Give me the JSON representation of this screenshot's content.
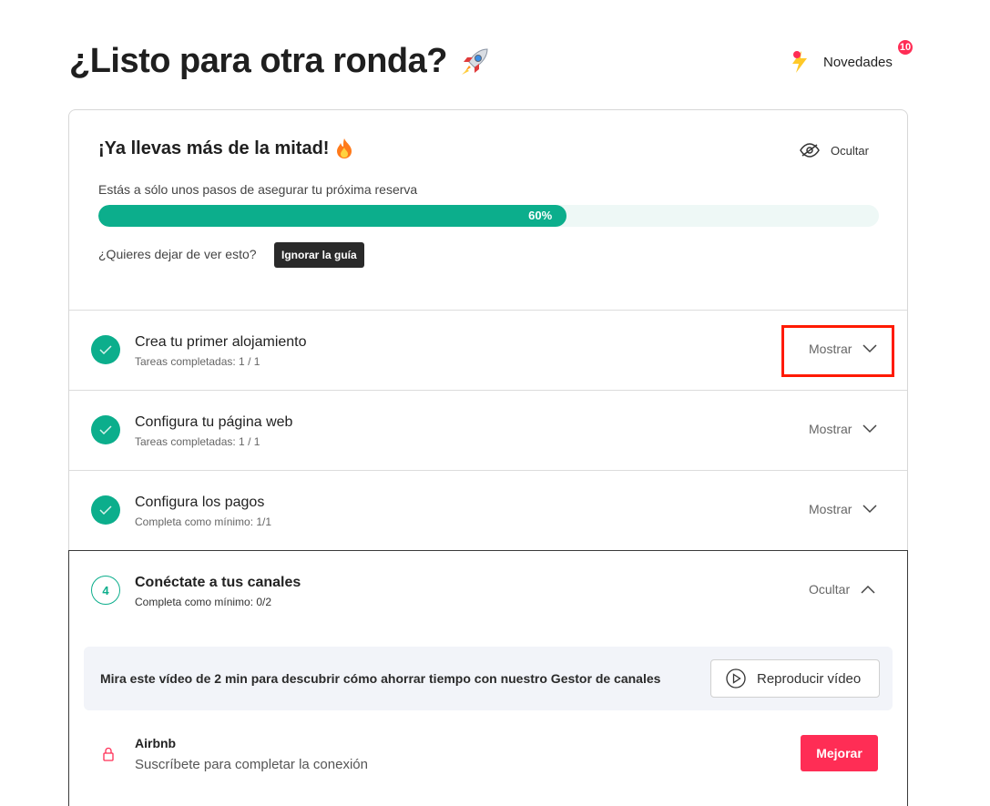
{
  "header": {
    "title": "¿Listo para otra ronda?",
    "news_label": "Novedades",
    "news_badge": "10"
  },
  "guide": {
    "title": "¡Ya llevas más de la mitad!",
    "hide_label": "Ocultar",
    "subtitle": "Estás a sólo unos pasos de asegurar tu próxima reserva",
    "progress_percent": 60,
    "progress_label": "60%",
    "quit_question": "¿Quieres dejar de ver esto?",
    "quit_button": "Ignorar la guía"
  },
  "steps": [
    {
      "title": "Crea tu primer alojamiento",
      "sub": "Tareas completadas: 1 / 1",
      "toggle": "Mostrar",
      "done": true
    },
    {
      "title": "Configura tu página web",
      "sub": "Tareas completadas: 1 / 1",
      "toggle": "Mostrar",
      "done": true
    },
    {
      "title": "Configura los pagos",
      "sub": "Completa como mínimo: 1/1",
      "toggle": "Mostrar",
      "done": true
    },
    {
      "title": "Conéctate a tus canales",
      "sub": "Completa como mínimo: 0/2",
      "toggle": "Ocultar",
      "done": false,
      "number": "4"
    }
  ],
  "video": {
    "text": "Mira este vídeo de 2 min para descubrir cómo ahorrar tiempo con nuestro Gestor de canales",
    "button": "Reproducir vídeo"
  },
  "channel": {
    "name": "Airbnb",
    "sub": "Suscríbete para completar la conexión",
    "button": "Mejorar"
  },
  "colors": {
    "accent": "#0cae8c",
    "badge": "#ff2d55",
    "highlight": "#ff1a00"
  }
}
